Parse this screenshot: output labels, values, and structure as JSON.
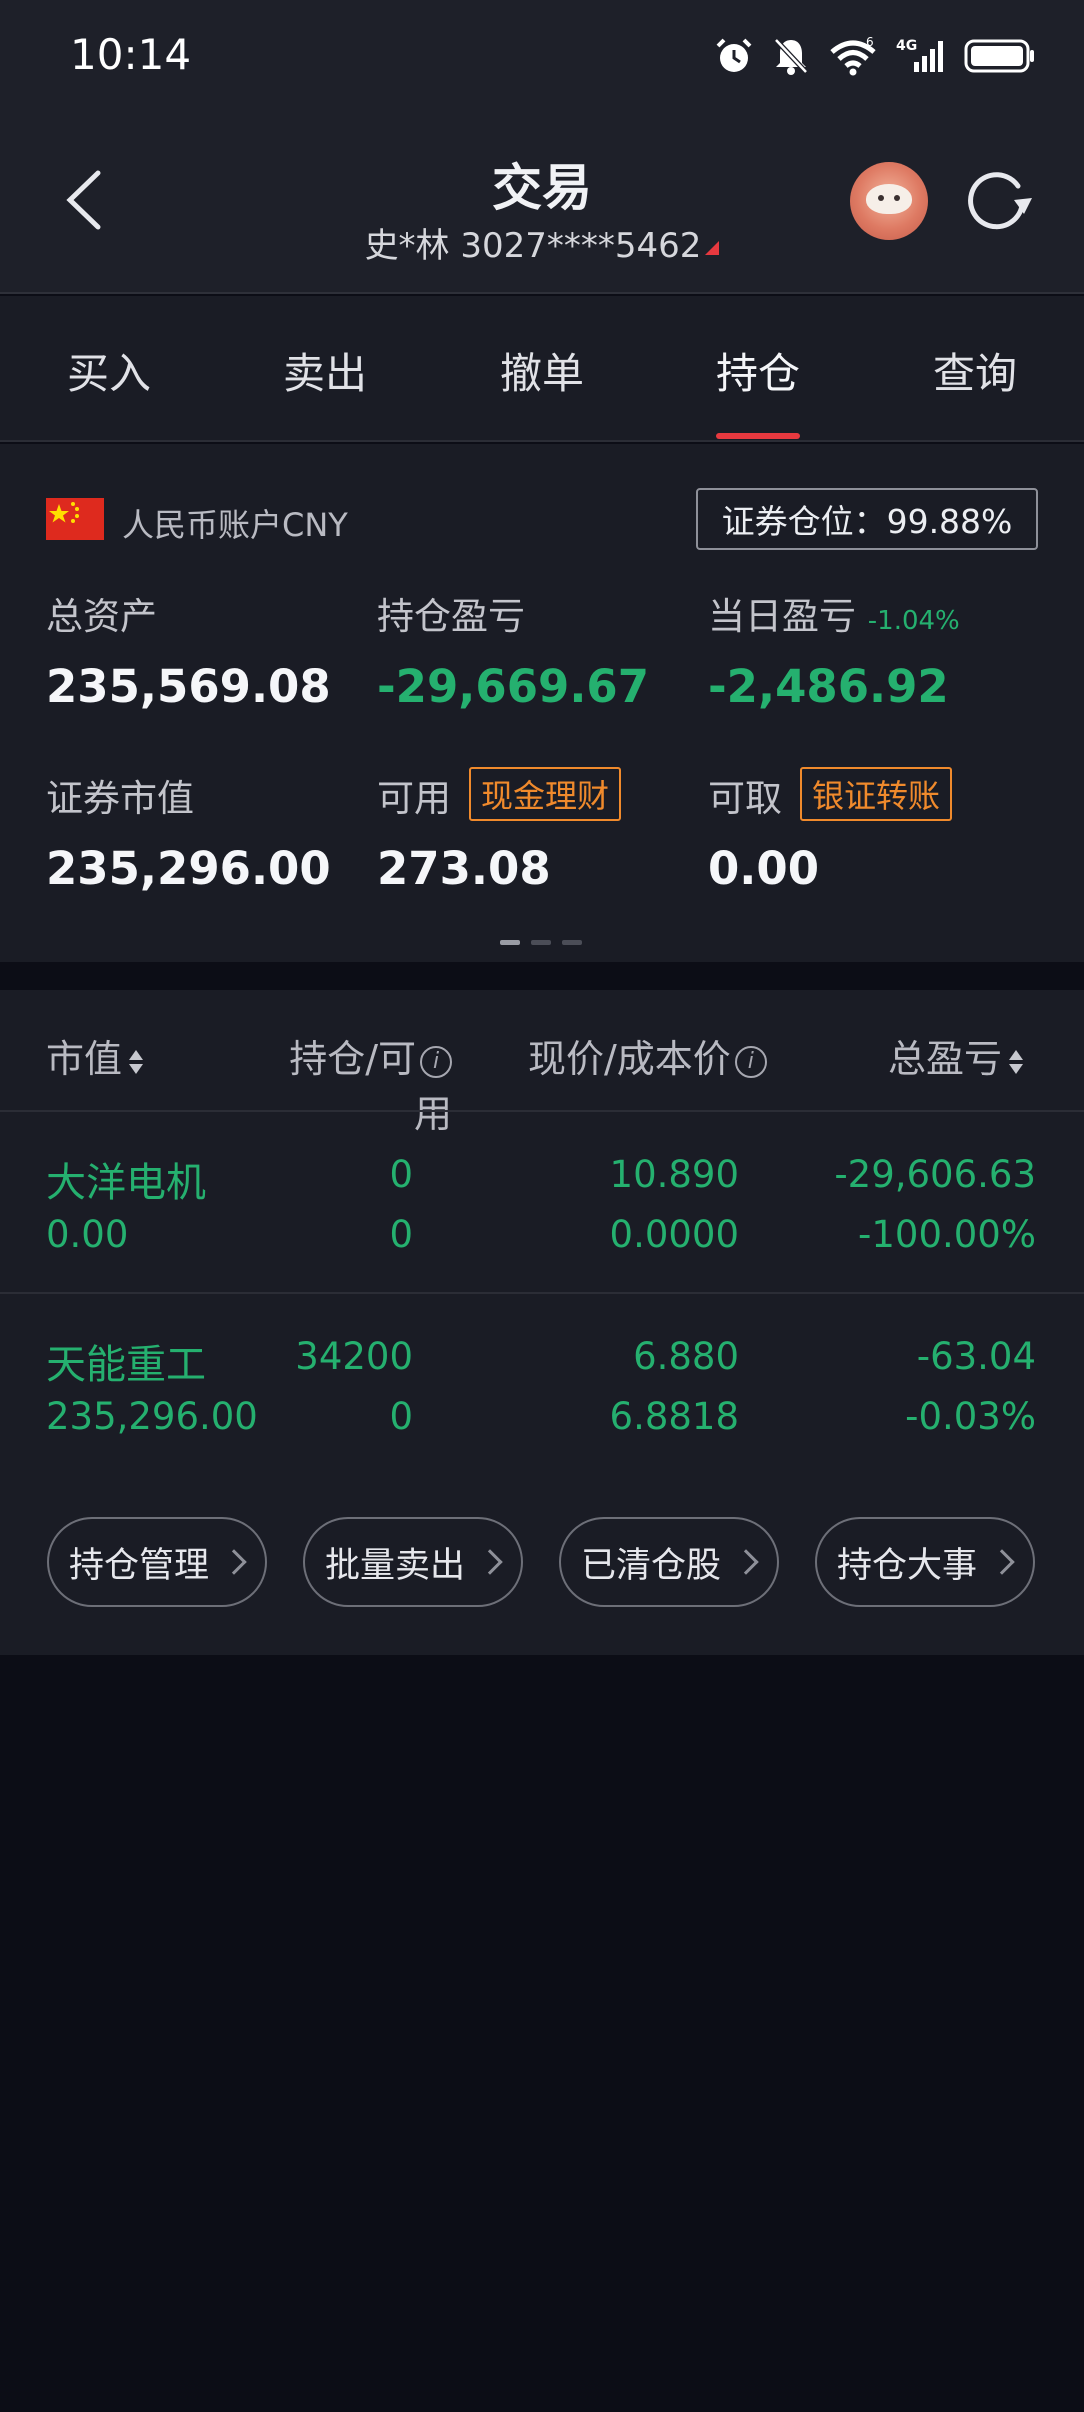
{
  "status_bar": {
    "time": "10:14",
    "icons": [
      "alarm-icon",
      "bell-muted-icon",
      "wifi-icon",
      "signal-4g-icon",
      "battery-icon"
    ],
    "wifi_badge": "6",
    "network": "4G"
  },
  "header": {
    "title": "交易",
    "account": "史*林 3027****5462"
  },
  "tabs": [
    {
      "label": "买入"
    },
    {
      "label": "卖出"
    },
    {
      "label": "撤单"
    },
    {
      "label": "持仓",
      "active": true
    },
    {
      "label": "查询"
    }
  ],
  "assets": {
    "account_label": "人民币账户CNY",
    "position_ratio": "证券仓位：99.88%",
    "total_assets_label": "总资产",
    "total_assets": "235,569.08",
    "holding_pnl_label": "持仓盈亏",
    "holding_pnl": "-29,669.67",
    "daily_pnl_label": "当日盈亏",
    "daily_pnl_pct": "-1.04%",
    "daily_pnl": "-2,486.92",
    "market_value_label": "证券市值",
    "market_value": "235,296.00",
    "available_label": "可用",
    "cash_wealth_tag": "现金理财",
    "available": "273.08",
    "withdrawable_label": "可取",
    "bank_transfer_tag": "银证转账",
    "withdrawable": "0.00",
    "page_indicator": {
      "count": 3,
      "active": 0
    }
  },
  "holdings": {
    "headers": {
      "market_value": "市值",
      "position_available": "持仓/可用",
      "price_cost": "现价/成本价",
      "total_pnl": "总盈亏"
    },
    "rows": [
      {
        "name": "大洋电机",
        "market_value": "0.00",
        "position": "0",
        "available": "0",
        "price": "10.890",
        "cost": "0.0000",
        "pnl": "-29,606.63",
        "pnl_pct": "-100.00%"
      },
      {
        "name": "天能重工",
        "market_value": "235,296.00",
        "position": "34200",
        "available": "0",
        "price": "6.880",
        "cost": "6.8818",
        "pnl": "-63.04",
        "pnl_pct": "-0.03%"
      }
    ]
  },
  "actions": [
    {
      "label": "持仓管理"
    },
    {
      "label": "批量卖出"
    },
    {
      "label": "已清仓股"
    },
    {
      "label": "持仓大事"
    }
  ],
  "colors": {
    "accent_red": "#e7393f",
    "loss_green": "#25b06f",
    "tag_orange": "#f08a2c",
    "panel_bg": "#1a1c25",
    "page_bg": "#0c0d16"
  }
}
